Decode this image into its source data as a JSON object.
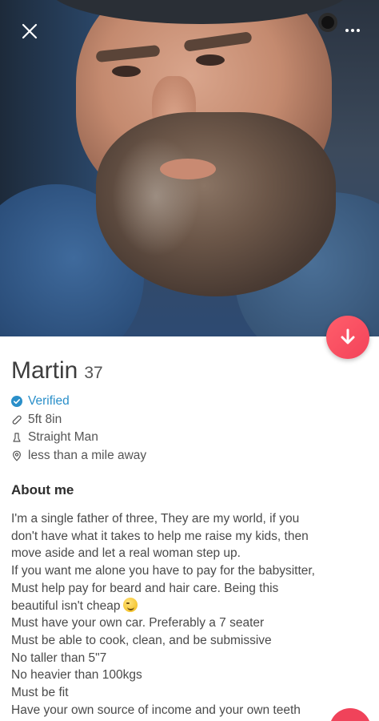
{
  "photo": {
    "alt": "profile photo of bearded man"
  },
  "top_bar": {
    "close_icon": "close-icon",
    "more_icon": "more-dots-icon"
  },
  "profile": {
    "name": "Martin",
    "age": "37",
    "verified_label": "Verified",
    "height": "5ft 8in",
    "orientation": "Straight Man",
    "distance": "less than a mile away"
  },
  "about": {
    "title": "About me",
    "lines": [
      "I'm a single father of three, They are my world, if you",
      "don't have what it takes to help me raise my kids, then",
      "move aside and let a real woman step up.",
      "If you want me alone you have to pay for the babysitter,",
      "Must help pay for beard and hair care. Being this",
      "beautiful isn't cheap",
      "Must have your own car. Preferably a 7 seater",
      "Must be able to cook, clean, and be submissive",
      "No taller than 5\"7",
      "No heavier than 100kgs",
      "Must be fit",
      "Have your own source of income and your own teeth"
    ]
  },
  "colors": {
    "accent": "#f3435a",
    "verified": "#2a8fc9"
  }
}
